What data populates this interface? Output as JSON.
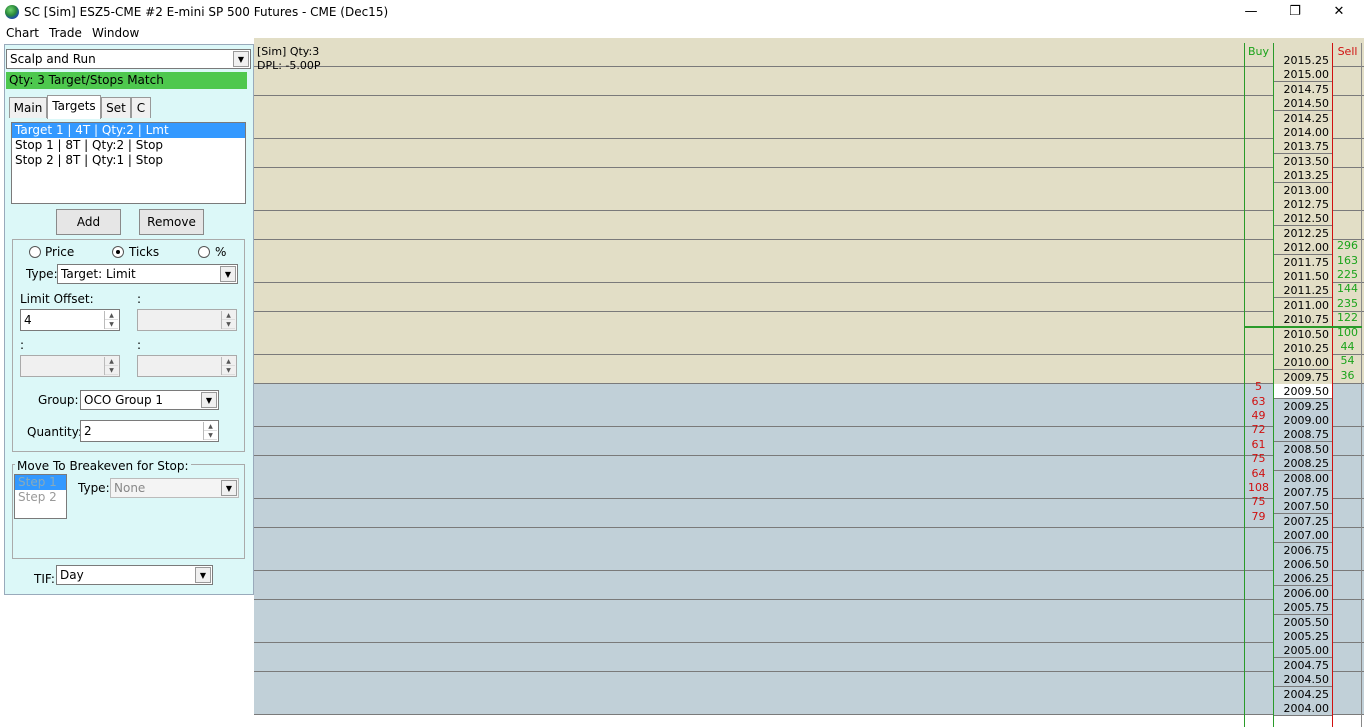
{
  "window": {
    "title": "SC [Sim] ESZ5-CME  #2  E-mini SP 500 Futures - CME (Dec15)",
    "minimize": "—",
    "maximize": "❐",
    "close": "✕"
  },
  "menu": [
    "Chart",
    "Trade",
    "Window"
  ],
  "panel": {
    "config_select": "Scalp and Run",
    "status": "Qty: 3 Target/Stops Match",
    "tabs": [
      "Main",
      "Targets",
      "Set",
      "C"
    ],
    "targets": [
      "Target 1 | 4T | Qty:2 | Lmt",
      "Stop 1 | 8T | Qty:2 | Stop",
      "Stop 2 | 8T | Qty:1 | Stop"
    ],
    "add_label": "Add",
    "remove_label": "Remove",
    "radio_price": "Price",
    "radio_ticks": "Ticks",
    "radio_percent": "%",
    "type_label": "Type:",
    "type_value": "Target: Limit",
    "limit_offset_label": "Limit Offset:",
    "colon_label": ":",
    "limit_offset_value": "4",
    "group_label": "Group:",
    "group_value": "OCO Group 1",
    "quantity_label": "Quantity:",
    "quantity_value": "2",
    "breakeven_title": "Move To Breakeven for Stop:",
    "steps": [
      "Step 1",
      "Step 2"
    ],
    "breakeven_type_label": "Type:",
    "breakeven_type_value": "None",
    "tif_label": "TIF:",
    "tif_value": "Day"
  },
  "ladder": {
    "sim_line": "[Sim]  Qty:3",
    "dpl_line": "DPL: -5.00P",
    "buy_header": "Buy",
    "sell_header": "Sell",
    "current_price": "2009.50",
    "prices": [
      "2015.25",
      "2015.00",
      "2014.75",
      "2014.50",
      "2014.25",
      "2014.00",
      "2013.75",
      "2013.50",
      "2013.25",
      "2013.00",
      "2012.75",
      "2012.50",
      "2012.25",
      "2012.00",
      "2011.75",
      "2011.50",
      "2011.25",
      "2011.00",
      "2010.75",
      "2010.50",
      "2010.25",
      "2010.00",
      "2009.75",
      "2009.50",
      "2009.25",
      "2009.00",
      "2008.75",
      "2008.50",
      "2008.25",
      "2008.00",
      "2007.75",
      "2007.50",
      "2007.25",
      "2007.00",
      "2006.75",
      "2006.50",
      "2006.25",
      "2006.00",
      "2005.75",
      "2005.50",
      "2005.25",
      "2005.00",
      "2004.75",
      "2004.50",
      "2004.25",
      "2004.00"
    ],
    "asks": {
      "2012.00": "296",
      "2011.75": "163",
      "2011.50": "225",
      "2011.25": "144",
      "2011.00": "235",
      "2010.75": "122",
      "2010.50": "100",
      "2010.25": "44",
      "2010.00": "54",
      "2009.75": "36"
    },
    "bids": {
      "2009.50": "5",
      "2009.25": "63",
      "2009.00": "49",
      "2008.75": "72",
      "2008.50": "61",
      "2008.25": "75",
      "2008.00": "64",
      "2007.75": "108",
      "2007.50": "75",
      "2007.25": "79"
    }
  }
}
